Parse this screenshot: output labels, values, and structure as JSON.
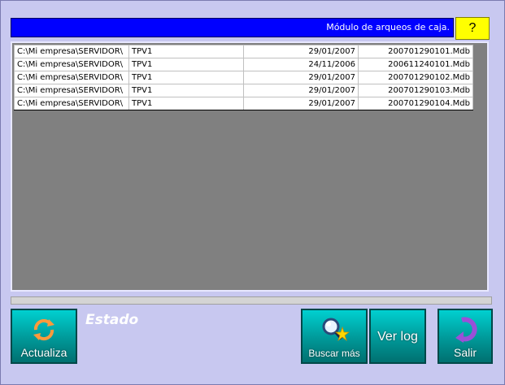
{
  "header": {
    "title": "Módulo de arqueos de caja.",
    "help_label": "?"
  },
  "files": {
    "rows": [
      {
        "path": "C:\\Mi empresa\\SERVIDOR\\",
        "terminal": "TPV1",
        "date": "29/01/2007",
        "file": "200701290101.Mdb"
      },
      {
        "path": "C:\\Mi empresa\\SERVIDOR\\",
        "terminal": "TPV1",
        "date": "24/11/2006",
        "file": "200611240101.Mdb"
      },
      {
        "path": "C:\\Mi empresa\\SERVIDOR\\",
        "terminal": "TPV1",
        "date": "29/01/2007",
        "file": "200701290102.Mdb"
      },
      {
        "path": "C:\\Mi empresa\\SERVIDOR\\",
        "terminal": "TPV1",
        "date": "29/01/2007",
        "file": "200701290103.Mdb"
      },
      {
        "path": "C:\\Mi empresa\\SERVIDOR\\",
        "terminal": "TPV1",
        "date": "29/01/2007",
        "file": "200701290104.Mdb"
      }
    ]
  },
  "status": {
    "label": "Estado"
  },
  "buttons": {
    "refresh": {
      "label": "Actualiza",
      "icon": "refresh-icon"
    },
    "search_more": {
      "label": "Buscar más",
      "icon": "magnifier-star-icon"
    },
    "view_log": {
      "label": "Ver log"
    },
    "exit": {
      "label": "Salir",
      "icon": "exit-arrow-icon"
    }
  },
  "colors": {
    "title_bar": "#0000ff",
    "help_button": "#ffff00",
    "button_teal": "#00a8a8",
    "background": "#c8c8f0"
  }
}
